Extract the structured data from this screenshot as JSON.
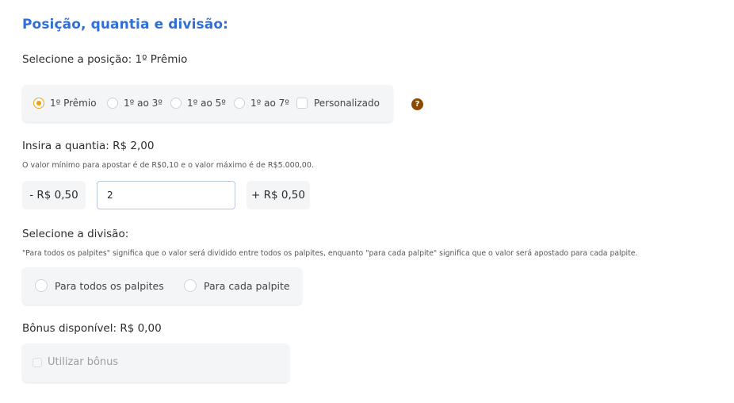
{
  "section_title": "Posição, quantia e divisão:",
  "position": {
    "label": "Selecione a posição: 1º Prêmio",
    "options": [
      "1º Prêmio",
      "1º ao 3º",
      "1º ao 5º",
      "1º ao 7º"
    ],
    "selected": "1º Prêmio",
    "custom_label": "Personalizado",
    "help_icon": "question-icon",
    "help_glyph": "?"
  },
  "amount": {
    "label": "Insira a quantia: R$ 2,00",
    "help": "O valor mínimo para apostar é de R$0,10 e o valor máximo é de R$5.000,00.",
    "decrement_label": "- R$ 0,50",
    "value": "2",
    "increment_label": "+ R$ 0,50"
  },
  "division": {
    "label": "Selecione a divisão:",
    "help": "\"Para todos os palpites\" significa que o valor será dividido entre todos os palpites, enquanto \"para cada palpite\" significa que o valor será apostado para cada palpite.",
    "options": [
      "Para todos os palpites",
      "Para cada palpite"
    ]
  },
  "bonus": {
    "label": "Bônus disponível: R$ 0,00",
    "use_label": "Utilizar bônus"
  },
  "colors": {
    "title": "#2f6fd6",
    "accent": "#f0a017",
    "help_icon_bg": "#8b4a00"
  }
}
